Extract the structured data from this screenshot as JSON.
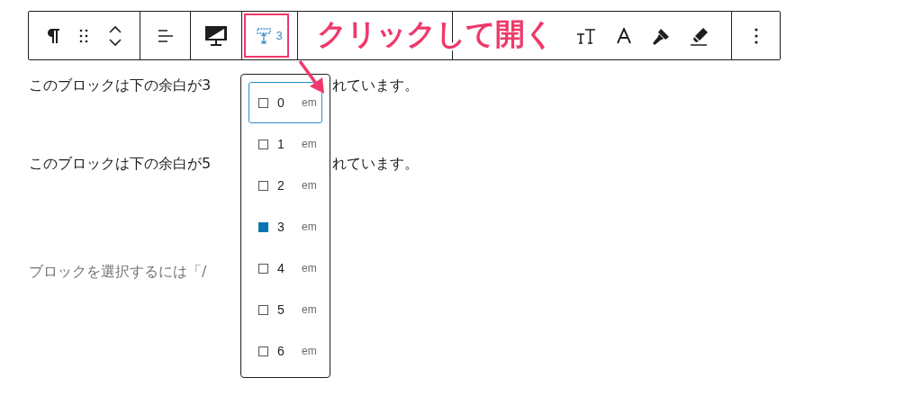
{
  "toolbar": {
    "spacing_button": {
      "label": "3"
    }
  },
  "annotation": {
    "text": "クリックして開く"
  },
  "paragraphs": [
    {
      "kind": "text",
      "before": "このブロックは下の余白が3",
      "after": "れています。"
    },
    {
      "kind": "text",
      "before": "このブロックは下の余白が5",
      "after": "れています。"
    },
    {
      "kind": "placeholder",
      "before": "ブロックを選択するには「/"
    }
  ],
  "dropdown": {
    "items": [
      {
        "value": "0",
        "unit": "em",
        "selected": false,
        "focused": true
      },
      {
        "value": "1",
        "unit": "em",
        "selected": false,
        "focused": false
      },
      {
        "value": "2",
        "unit": "em",
        "selected": false,
        "focused": false
      },
      {
        "value": "3",
        "unit": "em",
        "selected": true,
        "focused": false
      },
      {
        "value": "4",
        "unit": "em",
        "selected": false,
        "focused": false
      },
      {
        "value": "5",
        "unit": "em",
        "selected": false,
        "focused": false
      },
      {
        "value": "6",
        "unit": "em",
        "selected": false,
        "focused": false
      }
    ]
  }
}
